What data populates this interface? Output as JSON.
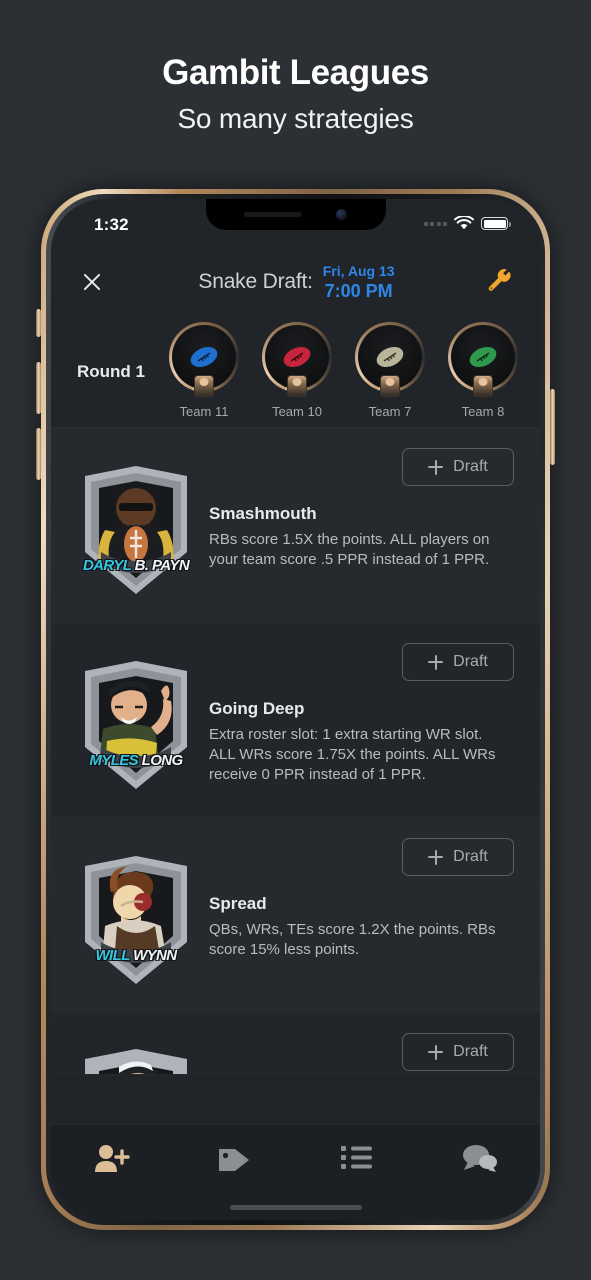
{
  "promo": {
    "title": "Gambit Leagues",
    "subtitle": "So many strategies"
  },
  "status_bar": {
    "time": "1:32",
    "signal_icon": "signal-dots-icon",
    "wifi_icon": "wifi-icon",
    "battery_icon": "battery-full-icon"
  },
  "header": {
    "close_icon": "close-icon",
    "title": "Snake Draft:",
    "date": "Fri, Aug 13",
    "time": "7:00 PM",
    "settings_icon": "wrench-icon",
    "accent_color": "#2d87e8",
    "wrench_color": "#f0a62c"
  },
  "round": {
    "label": "Round 1",
    "teams": [
      {
        "name": "Team 11",
        "ball_color": "#1f6fd0"
      },
      {
        "name": "Team 10",
        "ball_color": "#c6253c"
      },
      {
        "name": "Team 7",
        "ball_color": "#b9b59a"
      },
      {
        "name": "Team 8",
        "ball_color": "#2f9a4e"
      }
    ]
  },
  "strategies": [
    {
      "title": "Smashmouth",
      "description": "RBs score 1.5X the points. ALL players on your team score .5 PPR instead of 1 PPR.",
      "draft_label": "Draft",
      "crest_first_name": "DARYL",
      "crest_last_name": "B. PAYN",
      "avatar_icon": "player-crest-smashmouth"
    },
    {
      "title": "Going Deep",
      "description": "Extra roster slot: 1 extra starting WR slot. ALL WRs score 1.75X the points. ALL WRs receive 0 PPR instead of 1 PPR.",
      "draft_label": "Draft",
      "crest_first_name": "MYLES",
      "crest_last_name": "LONG",
      "avatar_icon": "player-crest-going-deep"
    },
    {
      "title": "Spread",
      "description": "QBs, WRs, TEs score 1.2X the points. RBs score 15% less points.",
      "draft_label": "Draft",
      "crest_first_name": "WILL",
      "crest_last_name": "WYNN",
      "avatar_icon": "player-crest-spread"
    },
    {
      "title": "",
      "description": "",
      "draft_label": "Draft",
      "crest_first_name": "",
      "crest_last_name": "",
      "avatar_icon": "player-crest-partial"
    }
  ],
  "tabbar": {
    "items": [
      {
        "icon": "person-add-icon",
        "active": true,
        "color": "#dcbd95"
      },
      {
        "icon": "tag-icon",
        "active": false,
        "color": "#8b8e92"
      },
      {
        "icon": "list-icon",
        "active": false,
        "color": "#8b8e92"
      },
      {
        "icon": "chat-icon",
        "active": false,
        "color": "#8b8e92"
      }
    ]
  }
}
